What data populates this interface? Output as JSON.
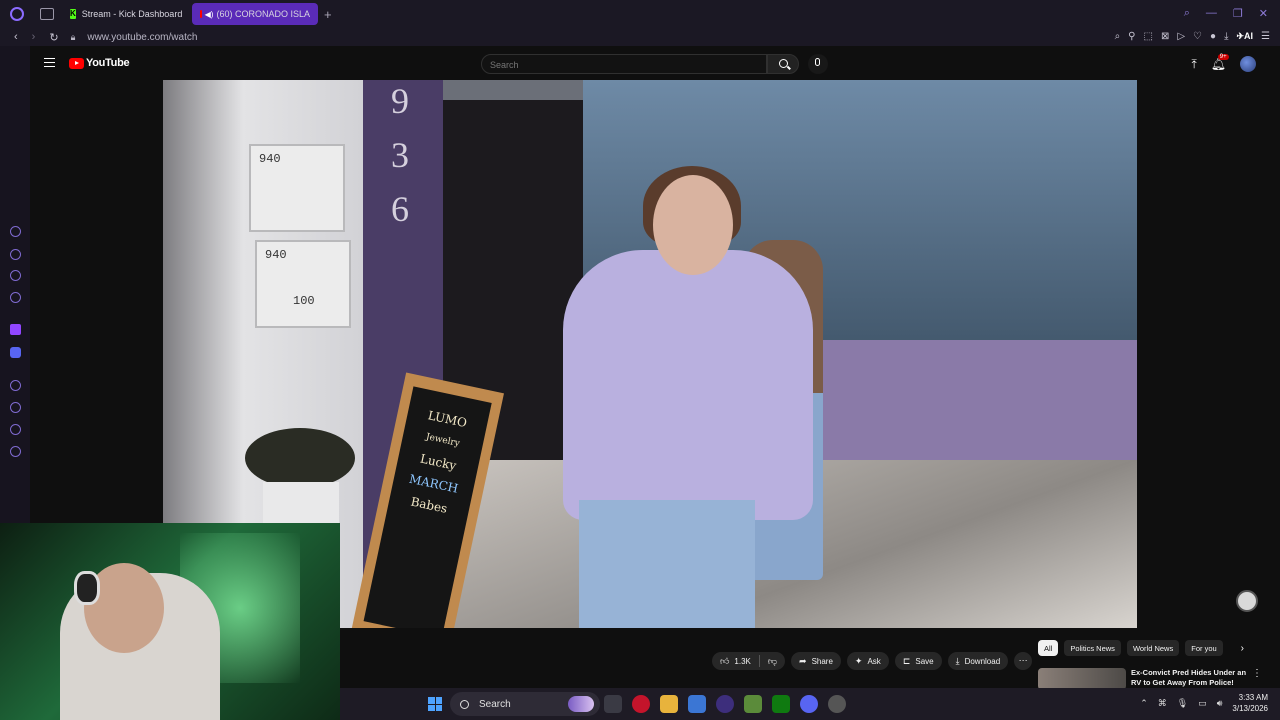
{
  "browser": {
    "tabs": [
      {
        "label": "Stream - Kick Dashboard",
        "favicon": "kick-icon",
        "active": false
      },
      {
        "label": "(60) CORONADO ISLA",
        "favicon": "youtube-icon",
        "active": true
      }
    ],
    "url": "www.youtube.com/watch",
    "ai_label": "AI",
    "accent": "#5a2bb8"
  },
  "youtube": {
    "logo_text": "YouTube",
    "search_placeholder": "Search",
    "notification_badge": "9+"
  },
  "video": {
    "mailbox_top": "940",
    "mailbox_bottom": "940",
    "mailbox_bottom_sub": "100",
    "house_numbers": [
      "9",
      "3",
      "6"
    ],
    "sign_lines": [
      "LUMO",
      "Jewelry",
      "Lucky",
      "MARCH",
      "Babes"
    ]
  },
  "actions": {
    "like_count": "1.3K",
    "share": "Share",
    "ask": "Ask",
    "save": "Save",
    "download": "Download"
  },
  "chips": [
    "All",
    "Politics News",
    "World News",
    "For you"
  ],
  "recommendation": {
    "title": "Ex-Convict Pred Hides Under an RV to Get Away From Police!"
  },
  "taskbar": {
    "search_label": "Search",
    "time": "3:33 AM",
    "date": "3/13/2026"
  }
}
